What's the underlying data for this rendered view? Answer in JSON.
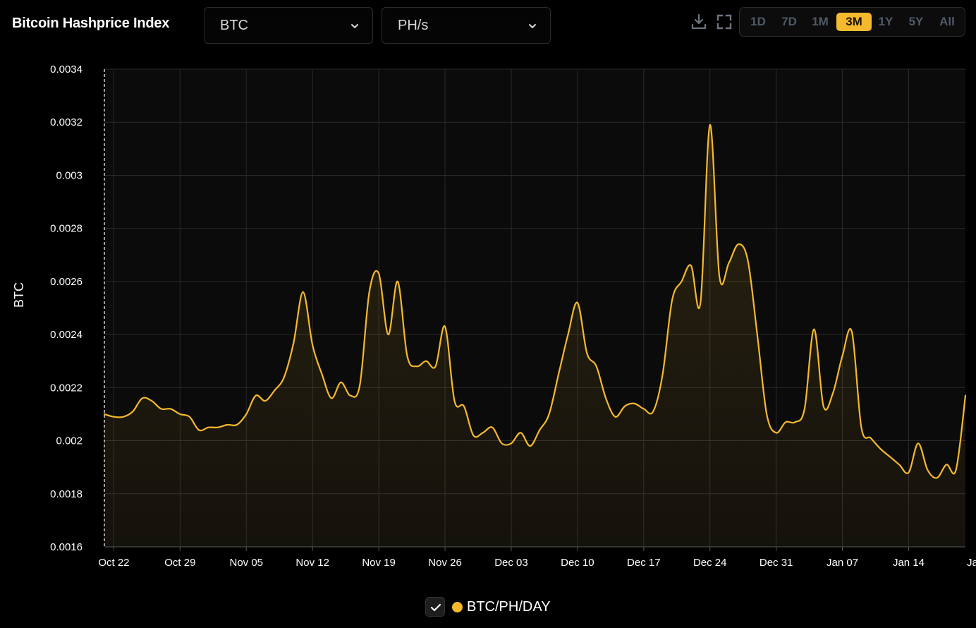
{
  "header": {
    "title": "Bitcoin Hashprice Index",
    "currency_select": {
      "value": "BTC"
    },
    "unit_select": {
      "value": "PH/s"
    },
    "tools": {
      "download_icon": "download-icon",
      "expand_icon": "fullscreen-icon"
    },
    "ranges": [
      {
        "label": "1D",
        "active": false
      },
      {
        "label": "7D",
        "active": false
      },
      {
        "label": "1M",
        "active": false
      },
      {
        "label": "3M",
        "active": true
      },
      {
        "label": "1Y",
        "active": false
      },
      {
        "label": "5Y",
        "active": false
      },
      {
        "label": "All",
        "active": false
      }
    ]
  },
  "colors": {
    "background": "#000000",
    "plot_background": "#0b0b0b",
    "accent": "#f5b92d",
    "grid": "#2a2a2a",
    "inactive_range": "#4f5a68"
  },
  "legend": {
    "label": "BTC/PH/DAY",
    "checked": true
  },
  "chart_data": {
    "type": "area",
    "title": "",
    "xlabel": "",
    "ylabel": "BTC",
    "ylim": [
      0.0016,
      0.0034
    ],
    "yticks": [
      0.0034,
      0.0032,
      0.003,
      0.0028,
      0.0026,
      0.0024,
      0.0022,
      0.002,
      0.0018,
      0.0016
    ],
    "ytick_labels": [
      "0.0034",
      "0.0032",
      "0.003",
      "0.0028",
      "0.0026",
      "0.0024",
      "0.0022",
      "0.002",
      "0.0018",
      "0.0016"
    ],
    "xlim": [
      "2023-10-21",
      "2024-01-20"
    ],
    "xticks": [
      "2023-10-22",
      "2023-10-29",
      "2023-11-05",
      "2023-11-12",
      "2023-11-19",
      "2023-11-26",
      "2023-12-03",
      "2023-12-10",
      "2023-12-17",
      "2023-12-24",
      "2023-12-31",
      "2024-01-07",
      "2024-01-14",
      "2024-01-21"
    ],
    "xtick_labels": [
      "Oct 22",
      "Oct 29",
      "Nov 05",
      "Nov 12",
      "Nov 19",
      "Nov 26",
      "Dec 03",
      "Dec 10",
      "Dec 17",
      "Dec 24",
      "Dec 31",
      "Jan 07",
      "Jan 14",
      "Jan"
    ],
    "grid": true,
    "legend_position": "bottom-center",
    "series": [
      {
        "name": "BTC/PH/DAY",
        "color": "#f5b92d",
        "points": [
          [
            "2023-10-21",
            0.0021
          ],
          [
            "2023-10-22",
            0.00209
          ],
          [
            "2023-10-23",
            0.00209
          ],
          [
            "2023-10-24",
            0.00211
          ],
          [
            "2023-10-25",
            0.00216
          ],
          [
            "2023-10-26",
            0.00215
          ],
          [
            "2023-10-27",
            0.00212
          ],
          [
            "2023-10-28",
            0.00212
          ],
          [
            "2023-10-29",
            0.0021
          ],
          [
            "2023-10-30",
            0.00209
          ],
          [
            "2023-10-31",
            0.00204
          ],
          [
            "2023-11-01",
            0.00205
          ],
          [
            "2023-11-02",
            0.00205
          ],
          [
            "2023-11-03",
            0.00206
          ],
          [
            "2023-11-04",
            0.00206
          ],
          [
            "2023-11-05",
            0.0021
          ],
          [
            "2023-11-06",
            0.00217
          ],
          [
            "2023-11-07",
            0.00215
          ],
          [
            "2023-11-08",
            0.00219
          ],
          [
            "2023-11-09",
            0.00224
          ],
          [
            "2023-11-10",
            0.00237
          ],
          [
            "2023-11-11",
            0.00256
          ],
          [
            "2023-11-12",
            0.00236
          ],
          [
            "2023-11-13",
            0.00225
          ],
          [
            "2023-11-14",
            0.00216
          ],
          [
            "2023-11-15",
            0.00222
          ],
          [
            "2023-11-16",
            0.00217
          ],
          [
            "2023-11-17",
            0.00221
          ],
          [
            "2023-11-18",
            0.00256
          ],
          [
            "2023-11-19",
            0.00263
          ],
          [
            "2023-11-20",
            0.0024
          ],
          [
            "2023-11-21",
            0.0026
          ],
          [
            "2023-11-22",
            0.00232
          ],
          [
            "2023-11-23",
            0.00228
          ],
          [
            "2023-11-24",
            0.0023
          ],
          [
            "2023-11-25",
            0.00228
          ],
          [
            "2023-11-26",
            0.00243
          ],
          [
            "2023-11-27",
            0.00215
          ],
          [
            "2023-11-28",
            0.00213
          ],
          [
            "2023-11-29",
            0.00202
          ],
          [
            "2023-11-30",
            0.00203
          ],
          [
            "2023-12-01",
            0.00205
          ],
          [
            "2023-12-02",
            0.00199
          ],
          [
            "2023-12-03",
            0.00199
          ],
          [
            "2023-12-04",
            0.00203
          ],
          [
            "2023-12-05",
            0.00198
          ],
          [
            "2023-12-06",
            0.00204
          ],
          [
            "2023-12-07",
            0.0021
          ],
          [
            "2023-12-08",
            0.00225
          ],
          [
            "2023-12-09",
            0.0024
          ],
          [
            "2023-12-10",
            0.00252
          ],
          [
            "2023-12-11",
            0.00233
          ],
          [
            "2023-12-12",
            0.00228
          ],
          [
            "2023-12-13",
            0.00216
          ],
          [
            "2023-12-14",
            0.00209
          ],
          [
            "2023-12-15",
            0.00213
          ],
          [
            "2023-12-16",
            0.00214
          ],
          [
            "2023-12-17",
            0.00212
          ],
          [
            "2023-12-18",
            0.00211
          ],
          [
            "2023-12-19",
            0.00225
          ],
          [
            "2023-12-20",
            0.00253
          ],
          [
            "2023-12-21",
            0.0026
          ],
          [
            "2023-12-22",
            0.00266
          ],
          [
            "2023-12-23",
            0.00252
          ],
          [
            "2023-12-24",
            0.00319
          ],
          [
            "2023-12-25",
            0.00262
          ],
          [
            "2023-12-26",
            0.00267
          ],
          [
            "2023-12-27",
            0.00274
          ],
          [
            "2023-12-28",
            0.00268
          ],
          [
            "2023-12-29",
            0.0024
          ],
          [
            "2023-12-30",
            0.0021
          ],
          [
            "2023-12-31",
            0.00203
          ],
          [
            "2024-01-01",
            0.00207
          ],
          [
            "2024-01-02",
            0.00207
          ],
          [
            "2024-01-03",
            0.00212
          ],
          [
            "2024-01-04",
            0.00242
          ],
          [
            "2024-01-05",
            0.00213
          ],
          [
            "2024-01-06",
            0.00218
          ],
          [
            "2024-01-07",
            0.00232
          ],
          [
            "2024-01-08",
            0.00241
          ],
          [
            "2024-01-09",
            0.00205
          ],
          [
            "2024-01-10",
            0.00201
          ],
          [
            "2024-01-11",
            0.00197
          ],
          [
            "2024-01-12",
            0.00194
          ],
          [
            "2024-01-13",
            0.00191
          ],
          [
            "2024-01-14",
            0.00188
          ],
          [
            "2024-01-15",
            0.00199
          ],
          [
            "2024-01-16",
            0.00189
          ],
          [
            "2024-01-17",
            0.00186
          ],
          [
            "2024-01-18",
            0.00191
          ],
          [
            "2024-01-19",
            0.00189
          ],
          [
            "2024-01-20",
            0.00217
          ]
        ]
      }
    ]
  }
}
